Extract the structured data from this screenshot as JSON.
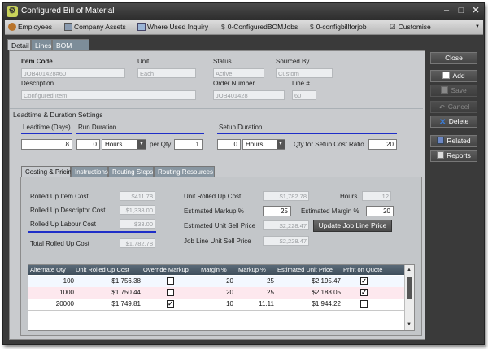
{
  "window": {
    "title": "Configured Bill of Material",
    "app_icon": "gear-icon"
  },
  "window_controls": {
    "minimize": "‒",
    "maximize": "□",
    "close": "✕"
  },
  "toolbar": {
    "items": [
      {
        "label": "Employees",
        "icon": "people-icon"
      },
      {
        "label": "Company Assets",
        "icon": "assets-icon"
      },
      {
        "label": "Where Used Inquiry",
        "icon": "inquiry-icon"
      },
      {
        "label": "0-ConfiguredBOMJobs",
        "icon": "dollar-icon"
      },
      {
        "label": "0-configbillforjob",
        "icon": "dollar-icon"
      },
      {
        "label": "Customise",
        "icon": "check-icon"
      }
    ]
  },
  "tabs": [
    "Detail",
    "Lines",
    "BOM Tree"
  ],
  "detail": {
    "item_code_label": "Item Code",
    "item_code": "JOB401428#60",
    "unit_label": "Unit",
    "unit": "Each",
    "status_label": "Status",
    "status": "Active",
    "sourced_by_label": "Sourced By",
    "sourced_by": "Custom",
    "description_label": "Description",
    "description": "Configured Item",
    "order_number_label": "Order Number",
    "order_number": "JOB401428",
    "line_label": "Line #",
    "line": "60"
  },
  "leadtime": {
    "section_title": "Leadtime & Duration Settings",
    "leadtime_label": "Leadtime (Days)",
    "leadtime": "8",
    "run_duration_label": "Run Duration",
    "run_duration": "0",
    "run_unit": "Hours",
    "per_qty_label": "per Qty",
    "per_qty": "1",
    "setup_duration_label": "Setup Duration",
    "setup_duration": "0",
    "setup_unit": "Hours",
    "qty_setup_label": "Qty for Setup Cost Ratio",
    "qty_setup": "20"
  },
  "subtabs": [
    "Costing & Pricing",
    "Instructions",
    "Routing Steps",
    "Routing Resources"
  ],
  "costing": {
    "item_cost_label": "Rolled Up Item Cost",
    "item_cost": "$411.78",
    "descriptor_cost_label": "Rolled Up Descriptor Cost",
    "descriptor_cost": "$1,338.00",
    "labour_cost_label": "Rolled Up Labour Cost",
    "labour_cost": "$33.00",
    "total_cost_label": "Total Rolled Up Cost",
    "total_cost": "$1,782.78",
    "unit_cost_label": "Unit Rolled Up Cost",
    "unit_cost": "$1,782.78",
    "hours_label": "Hours",
    "hours": "12",
    "est_markup_label": "Estimated Markup %",
    "est_markup": "25",
    "est_margin_label": "Estimated Margin %",
    "est_margin": "20",
    "est_sell_label": "Estimated Unit Sell Price",
    "est_sell": "$2,228.47",
    "update_button": "Update Job Line Price",
    "job_line_label": "Job Line Unit Sell Price",
    "job_line": "$2,228.47"
  },
  "grid": {
    "headers": [
      "Alternate Qty",
      "Unit Rolled Up Cost",
      "Override Markup",
      "Margin %",
      "Markup %",
      "Estimated Unit Price",
      "Print on Quote"
    ],
    "rows": [
      {
        "qty": "100",
        "cost": "$1,756.38",
        "override": false,
        "margin": "20",
        "markup": "25",
        "price": "$2,195.47",
        "print": true
      },
      {
        "qty": "1000",
        "cost": "$1,750.44",
        "override": false,
        "margin": "20",
        "markup": "25",
        "price": "$2,188.05",
        "print": true
      },
      {
        "qty": "20000",
        "cost": "$1,749.81",
        "override": true,
        "margin": "10",
        "markup": "11.11",
        "price": "$1,944.22",
        "print": false
      }
    ]
  },
  "actions": [
    "Close",
    "Add",
    "Save",
    "Cancel",
    "Delete",
    "Related",
    "Reports"
  ],
  "colors": {
    "accent_line": "#1e2ec8",
    "header": "#3f4e5b",
    "row_alt": "#fde8ee"
  }
}
